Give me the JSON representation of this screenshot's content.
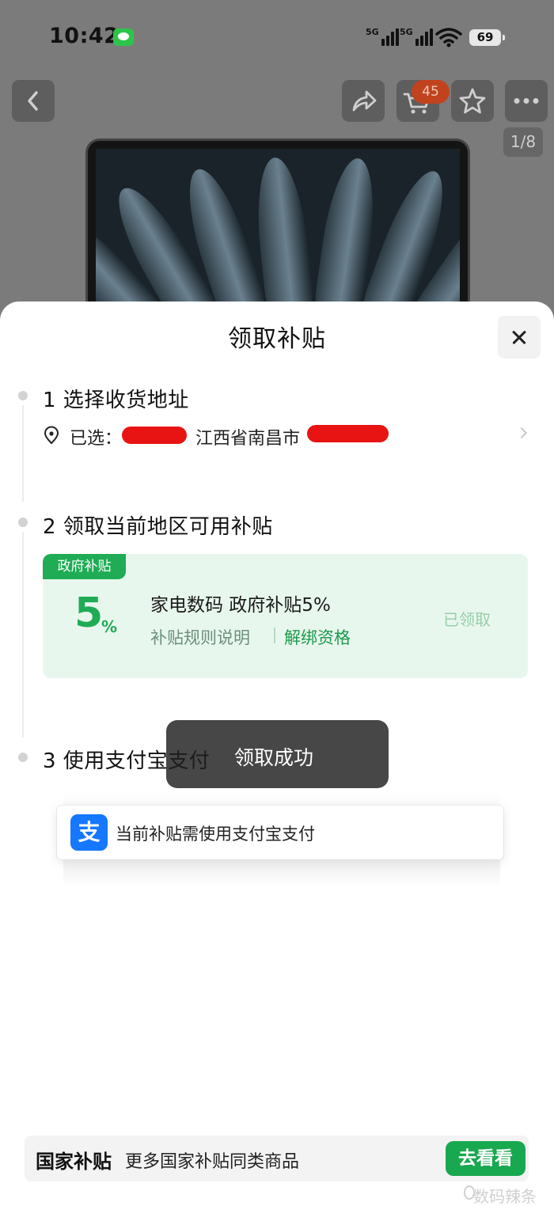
{
  "status_bar": {
    "time": "10:42",
    "network_1": "5G",
    "network_2": "5G",
    "battery": "69"
  },
  "header": {
    "cart_badge": "45",
    "pager": "1/8"
  },
  "sheet": {
    "title": "领取补贴",
    "step1": {
      "title": "1 选择收货地址",
      "address_prefix": "已选：",
      "address_city": "江西省南昌市"
    },
    "step2": {
      "title": "2 领取当前地区可用补贴",
      "card": {
        "tag": "政府补贴",
        "percent": "5",
        "percent_sign": "%",
        "title": "家电数码 政府补贴5%",
        "rules_link": "补贴规则说明",
        "unbind_link": "解绑资格",
        "status": "已领取"
      }
    },
    "step3": {
      "title": "3 使用支付宝支付",
      "alipay_logo": "支",
      "alipay_notice": "当前补贴需使用支付宝支付"
    }
  },
  "toast": {
    "text": "领取成功"
  },
  "bottom_bar": {
    "title": "国家补贴",
    "text": "更多国家补贴同类商品",
    "button": "去看看"
  },
  "watermark": "数码辣条"
}
